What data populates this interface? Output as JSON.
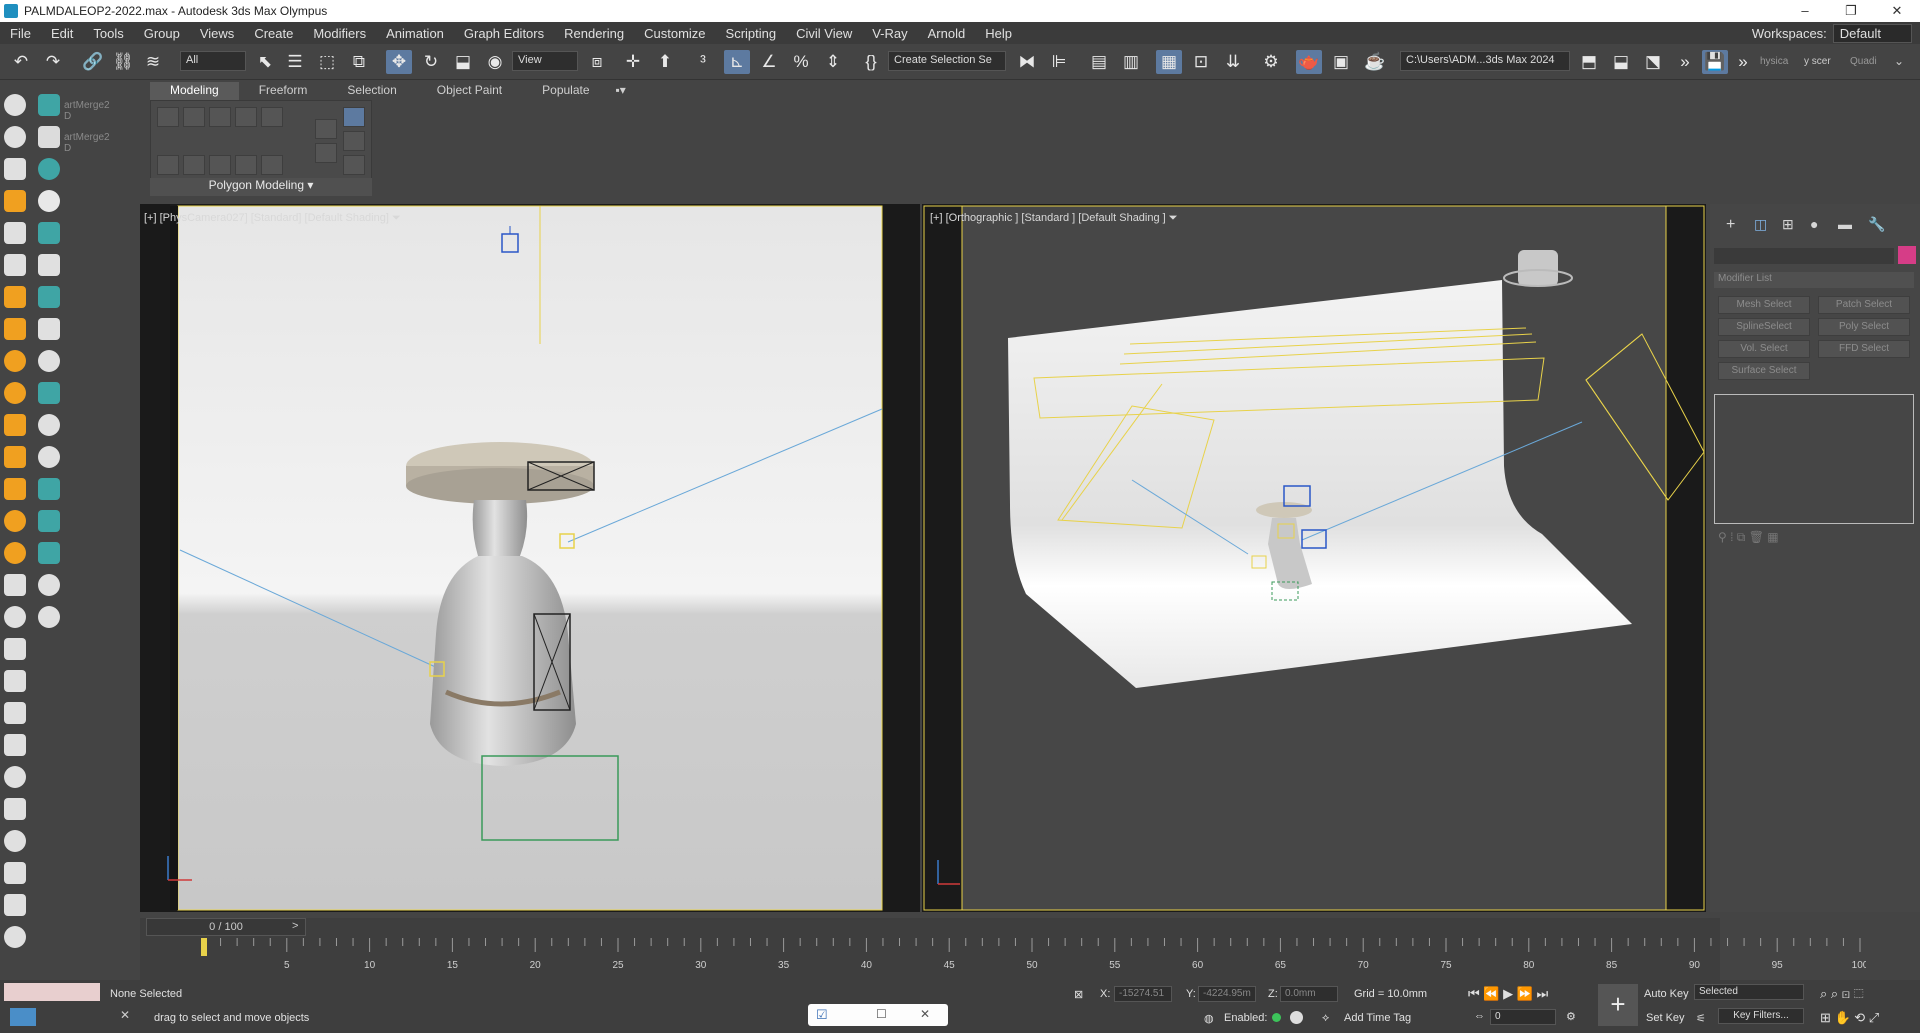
{
  "window": {
    "title": "PALMDALEOP2-2022.max - Autodesk 3ds Max Olympus",
    "controls": [
      "–",
      "❐",
      "✕"
    ]
  },
  "menu": {
    "items": [
      "File",
      "Edit",
      "Tools",
      "Group",
      "Views",
      "Create",
      "Modifiers",
      "Animation",
      "Graph Editors",
      "Rendering",
      "Customize",
      "Scripting",
      "Civil View",
      "V-Ray",
      "Arnold",
      "Help"
    ],
    "workspaces_label": "Workspaces:",
    "workspaces_value": "Default"
  },
  "toolbar": {
    "selection_filter": "All",
    "ref_coord": "View",
    "named_selection": "Create Selection Se",
    "project_path": "C:\\Users\\ADM...3ds Max 2024",
    "right_labels": [
      "hysica",
      "y scer",
      "Quadi"
    ]
  },
  "ribbon": {
    "tabs": [
      "Modeling",
      "Freeform",
      "Selection",
      "Object Paint",
      "Populate"
    ],
    "active_tab": "Modeling",
    "group_label": "Polygon Modeling"
  },
  "left_panel": {
    "labels": [
      "artMerge2 D",
      "artMerge2 D"
    ]
  },
  "viewport_left": {
    "label_prefix": "[+] [",
    "camera": "PhysCamera027",
    "label_suffix": "] [Standard] [Default Shading]"
  },
  "viewport_right": {
    "label": "[+] [Orthographic ] [Standard ] [Default Shading ]"
  },
  "command_panel": {
    "modifier_list": "Modifier List",
    "buttons": [
      "Mesh Select",
      "Patch Select",
      "SplineSelect",
      "Poly Select",
      "Vol. Select",
      "FFD Select",
      "Surface Select"
    ],
    "object_color": "#d63d87"
  },
  "timeline": {
    "slider_text": "0 / 100",
    "ticks": [
      "5",
      "10",
      "15",
      "20",
      "25",
      "30",
      "35",
      "40",
      "45",
      "50",
      "55",
      "60",
      "65",
      "70",
      "75",
      "80",
      "85",
      "90",
      "95",
      "100"
    ]
  },
  "status": {
    "selection": "None Selected",
    "prompt": "drag to select and move objects",
    "x_label": "X:",
    "x_value": "-15274.51",
    "y_label": "Y:",
    "y_value": "-4224.95m",
    "z_label": "Z:",
    "z_value": "0.0mm",
    "grid": "Grid = 10.0mm",
    "enabled_label": "Enabled:",
    "add_time_tag": "Add Time Tag",
    "auto_key": "Auto Key",
    "set_key": "Set Key",
    "key_mode": "Selected",
    "key_filters": "Key Filters...",
    "frame": "0"
  }
}
